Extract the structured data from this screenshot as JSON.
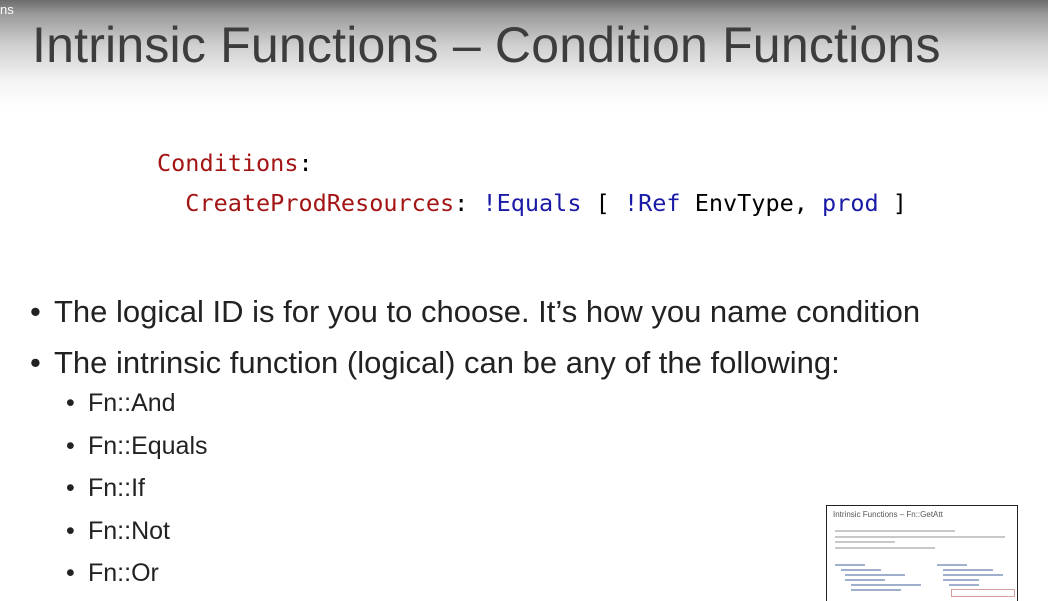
{
  "corner_label": "ns",
  "slide": {
    "title": "Intrinsic Functions – Condition Functions",
    "code": {
      "line1_key": "Conditions",
      "line1_colon": ":",
      "line2_key": "CreateProdResources",
      "line2_colon": ":",
      "equals_fn": "!Equals",
      "open_bracket": "[",
      "ref_fn": "!Ref",
      "ref_target": "EnvType,",
      "value": "prod",
      "close_bracket": "]"
    },
    "bullets": [
      "The logical ID is for you to choose. It’s how you name condition",
      "The intrinsic function (logical) can be any of the following:"
    ],
    "sub_bullets": [
      "Fn::And",
      "Fn::Equals",
      "Fn::If",
      "Fn::Not",
      "Fn::Or"
    ]
  },
  "thumbnail": {
    "title": "Intrinsic Functions – Fn::GetAtt"
  },
  "colors": {
    "code_key": "#a31515",
    "code_function": "#1a1aa6",
    "title_text": "#3d3d3d",
    "body_text": "#222222"
  }
}
